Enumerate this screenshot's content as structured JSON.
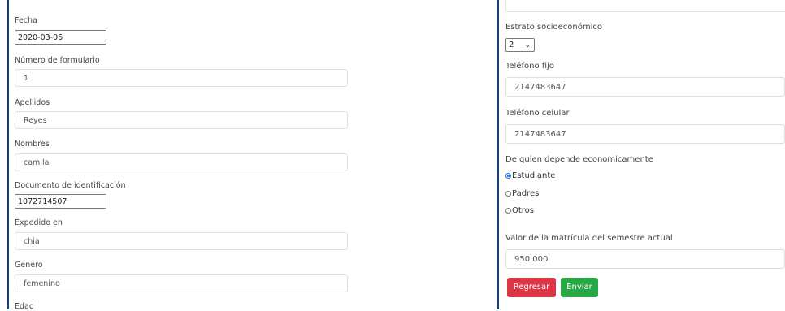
{
  "left": {
    "fecha": {
      "label": "Fecha",
      "value": "2020-03-06"
    },
    "numero_formulario": {
      "label": "Número de formulario",
      "value": "1"
    },
    "apellidos": {
      "label": "Apellidos",
      "value": "Reyes"
    },
    "nombres": {
      "label": "Nombres",
      "value": "camila"
    },
    "documento": {
      "label": "Documento de identificación",
      "value": "1072714507"
    },
    "expedido": {
      "label": "Expedido en",
      "value": "chia"
    },
    "genero": {
      "label": "Genero",
      "value": "femenino"
    },
    "edad": {
      "label": "Edad"
    }
  },
  "right": {
    "estrato": {
      "label": "Estrato socioeconómico",
      "value": "2"
    },
    "telefono_fijo": {
      "label": "Teléfono fijo",
      "value": "2147483647"
    },
    "telefono_celular": {
      "label": "Teléfono celular",
      "value": "2147483647"
    },
    "dependencia": {
      "label": "De quien depende economicamente",
      "options": [
        "Estudiante",
        "Padres",
        "Otros"
      ],
      "selected": "Estudiante"
    },
    "matricula": {
      "label": "Valor de la matrícula del semestre actual",
      "value": "950.000"
    },
    "buttons": {
      "regresar": "Regresar",
      "enviar": "Enviar"
    }
  },
  "colors": {
    "accent_bar": "#1a3b73",
    "danger": "#dc3545",
    "success": "#28a745",
    "radio": "#1a73e8"
  },
  "icons": {
    "select_chevron": "chevron-down-icon"
  }
}
